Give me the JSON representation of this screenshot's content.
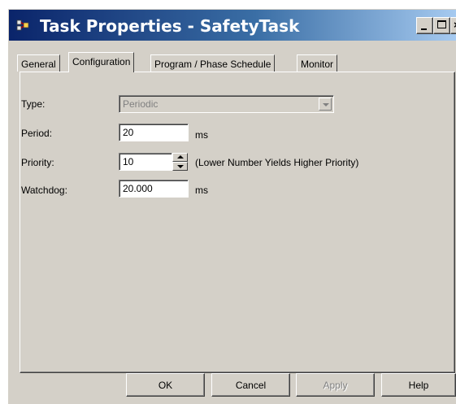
{
  "window": {
    "title": "Task Properties - SafetyTask",
    "icon": "task-icon"
  },
  "caption_buttons": {
    "close_glyph": "×"
  },
  "tabs": [
    {
      "label": "General",
      "active": false
    },
    {
      "label": "Configuration",
      "active": true
    },
    {
      "label": "Program / Phase Schedule",
      "active": false
    },
    {
      "label": "Monitor",
      "active": false
    }
  ],
  "form": {
    "type": {
      "label": "Type:",
      "value": "Periodic"
    },
    "period": {
      "label": "Period:",
      "value": "20",
      "unit": "ms"
    },
    "priority": {
      "label": "Priority:",
      "value": "10",
      "hint": "(Lower Number Yields Higher Priority)"
    },
    "watchdog": {
      "label": "Watchdog:",
      "value": "20.000",
      "unit": "ms"
    }
  },
  "buttons": {
    "ok": "OK",
    "cancel": "Cancel",
    "apply": "Apply",
    "help": "Help"
  },
  "colors": {
    "face": "#d4d0c8",
    "title_start": "#0a246a",
    "title_end": "#a6caf0"
  }
}
